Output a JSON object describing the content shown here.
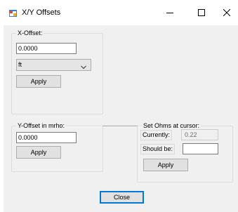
{
  "window": {
    "title": "X/Y Offsets",
    "icon": "app-window-icon",
    "controls": [
      "minimize-icon",
      "maximize-icon",
      "close-icon"
    ]
  },
  "x_offset": {
    "group_label": "X-Offset:",
    "value": "0.0000",
    "unit_selected": "ft",
    "apply_label": "Apply"
  },
  "y_offset": {
    "group_label": "Y-Offset in mrho:",
    "value": "0.0000",
    "apply_label": "Apply"
  },
  "set_ohms": {
    "group_label": "Set Ohms at cursor:",
    "currently_label": "Currently:",
    "currently_value": "0.22",
    "should_be_label": "Should be:",
    "should_be_value": "",
    "apply_label": "Apply"
  },
  "footer": {
    "close_label": "Close"
  },
  "colors": {
    "dialog_bg": "#f0f0f0",
    "button_bg": "#e1e1e1",
    "default_button_border": "#0078d7"
  }
}
